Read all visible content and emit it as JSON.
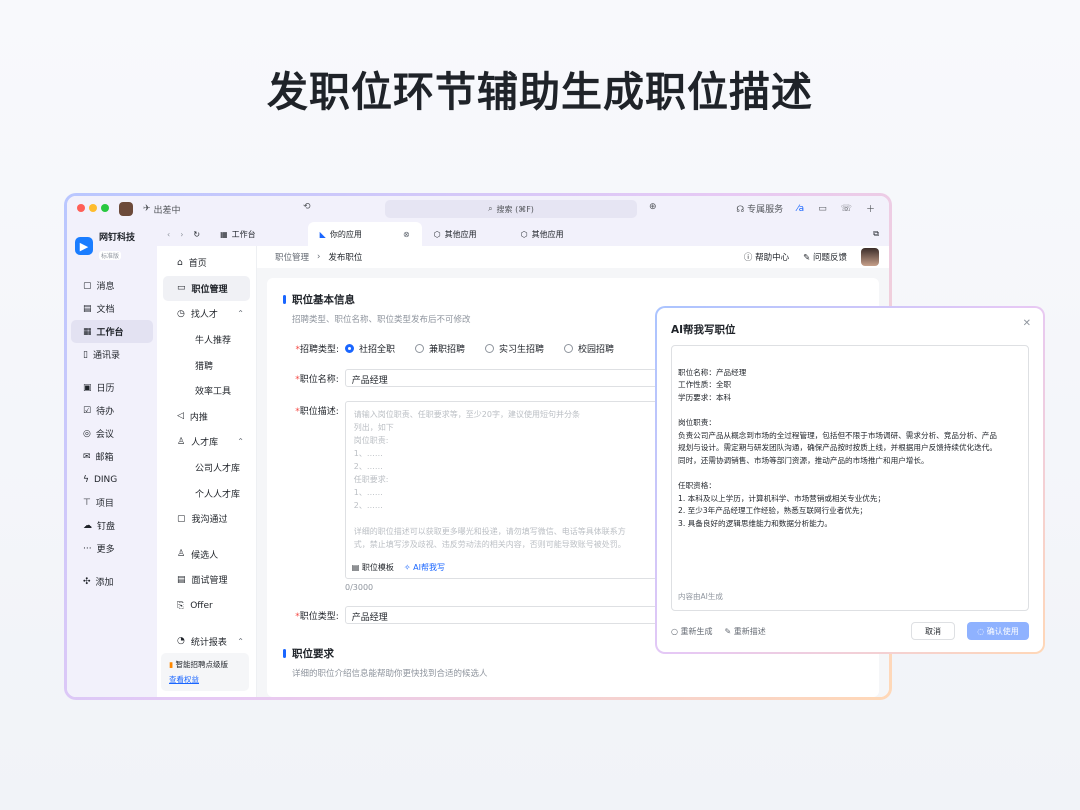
{
  "headline": "发职位环节辅助生成职位描述",
  "titlebar": {
    "status": "出差中",
    "search": "搜索 (⌘F)",
    "service": "专属服务"
  },
  "org": {
    "name": "网钉科技",
    "tag": "标准版"
  },
  "nav1": [
    "消息",
    "文档",
    "工作台",
    "通讯录",
    "日历",
    "待办",
    "会议",
    "邮箱",
    "DING",
    "项目",
    "钉盘",
    "更多",
    "添加"
  ],
  "tabs": [
    "工作台",
    "你的应用",
    "其他应用",
    "其他应用"
  ],
  "nav2": {
    "home": "首页",
    "job_mgmt": "职位管理",
    "find_talent": "找人才",
    "niu_recommend": "牛人推荐",
    "headhunt": "猎聘",
    "tools": "效率工具",
    "referral": "内推",
    "talent_pool": "人才库",
    "company_pool": "公司人才库",
    "personal_pool": "个人人才库",
    "contacted": "我沟通过",
    "candidates": "候选人",
    "interview": "面试管理",
    "offer": "Offer",
    "report": "统计报表"
  },
  "upgrade": {
    "text": "智能招聘点级版",
    "link": "查看权益"
  },
  "crumb": {
    "parent": "职位管理",
    "current": "发布职位",
    "help": "帮助中心",
    "feedback": "问题反馈"
  },
  "form": {
    "section_title": "职位基本信息",
    "section_sub": "招聘类型、职位名称、职位类型发布后不可修改",
    "type_label": "招聘类型:",
    "types": [
      "社招全职",
      "兼职招聘",
      "实习生招聘",
      "校园招聘"
    ],
    "name_label": "职位名称:",
    "name_value": "产品经理",
    "desc_label": "职位描述:",
    "desc_placeholder": "请输入岗位职责、任职要求等，至少20字，建议使用短句并分条\n列出，如下\n岗位职责:\n1、……\n2、……\n任职要求:\n1、……\n2、……\n\n详细的职位描述可以获取更多曝光和投递，请勿填写微信、电话等具体联系方\n式，禁止填写涉及歧视、违反劳动法的相关内容，否则可能导致账号被处罚。",
    "template_btn": "职位模板",
    "ai_btn": "AI帮我写",
    "count": "0/3000",
    "category_label": "职位类型:",
    "category_value": "产品经理",
    "section2_title": "职位要求",
    "section2_sub": "详细的职位介绍信息能帮助你更快找到合适的候选人"
  },
  "dialog": {
    "title": "AI帮我写职位",
    "content": "职位名称：产品经理\n工作性质：全职\n学历要求：本科\n\n岗位职责：\n负责公司产品从概念到市场的全过程管理，包括但不限于市场调研、需求分析、竞品分析、产品\n规划与设计。需定期与研发团队沟通，确保产品按时按质上线，并根据用户反馈持续优化迭代。\n同时，还需协调销售、市场等部门资源，推动产品的市场推广和用户增长。\n\n任职资格：\n1. 本科及以上学历，计算机科学、市场营销或相关专业优先；\n2. 至少3年产品经理工作经验，熟悉互联网行业者优先；\n3. 具备良好的逻辑思维能力和数据分析能力。",
    "hint": "内容由AI生成",
    "regen": "重新生成",
    "redesc": "重新描述",
    "cancel": "取消",
    "confirm": "确认使用"
  }
}
